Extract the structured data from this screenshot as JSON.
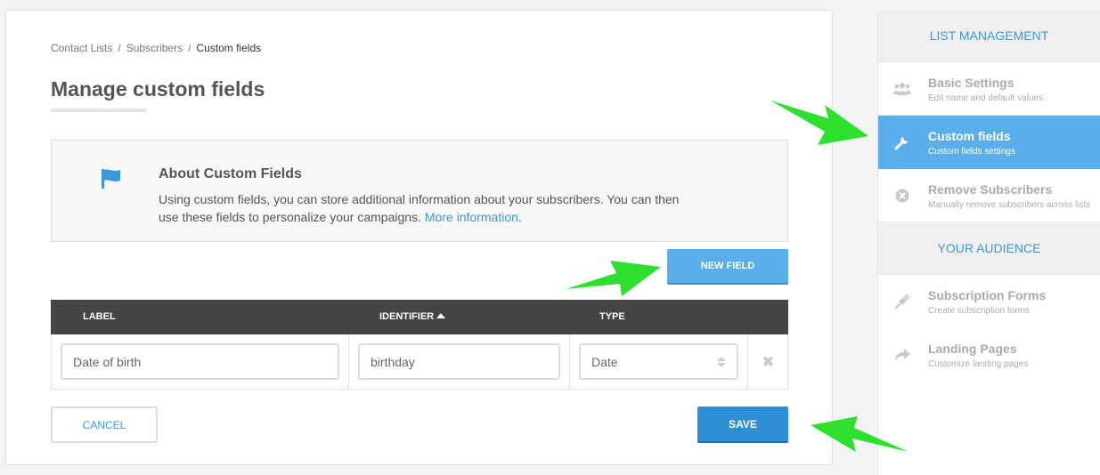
{
  "breadcrumb": {
    "items": [
      "Contact Lists",
      "Subscribers"
    ],
    "separator": "/",
    "current": "Custom fields"
  },
  "page": {
    "title": "Manage custom fields"
  },
  "about": {
    "title": "About Custom Fields",
    "text": "Using custom fields, you can store additional information about your subscribers. You can then use these fields to personalize your campaigns.",
    "link_label": "More information",
    "trailing": "."
  },
  "actions": {
    "new_field_label": "NEW FIELD",
    "cancel_label": "CANCEL",
    "save_label": "SAVE"
  },
  "table": {
    "headers": {
      "label": "LABEL",
      "identifier": "IDENTIFIER",
      "type": "TYPE"
    },
    "rows": [
      {
        "label": "Date of birth",
        "identifier": "birthday",
        "type": "Date"
      }
    ]
  },
  "sidebar": {
    "section1_title": "LIST MANAGEMENT",
    "items1": [
      {
        "title": "Basic Settings",
        "subtitle": "Edit name and default values",
        "icon": "users-icon"
      },
      {
        "title": "Custom fields",
        "subtitle": "Custom fields settings",
        "icon": "wrench-icon"
      },
      {
        "title": "Remove Subscribers",
        "subtitle": "Manually remove subscribers across lists",
        "icon": "remove-circle-icon"
      }
    ],
    "section2_title": "YOUR AUDIENCE",
    "items2": [
      {
        "title": "Subscription Forms",
        "subtitle": "Create subscription forms",
        "icon": "plug-icon"
      },
      {
        "title": "Landing Pages",
        "subtitle": "Customize landing pages",
        "icon": "share-arrow-icon"
      }
    ]
  },
  "colors": {
    "accent": "#5aafea",
    "save": "#2f8fd6",
    "link": "#3a9ad9",
    "annotation_arrow": "#2ee02e"
  }
}
